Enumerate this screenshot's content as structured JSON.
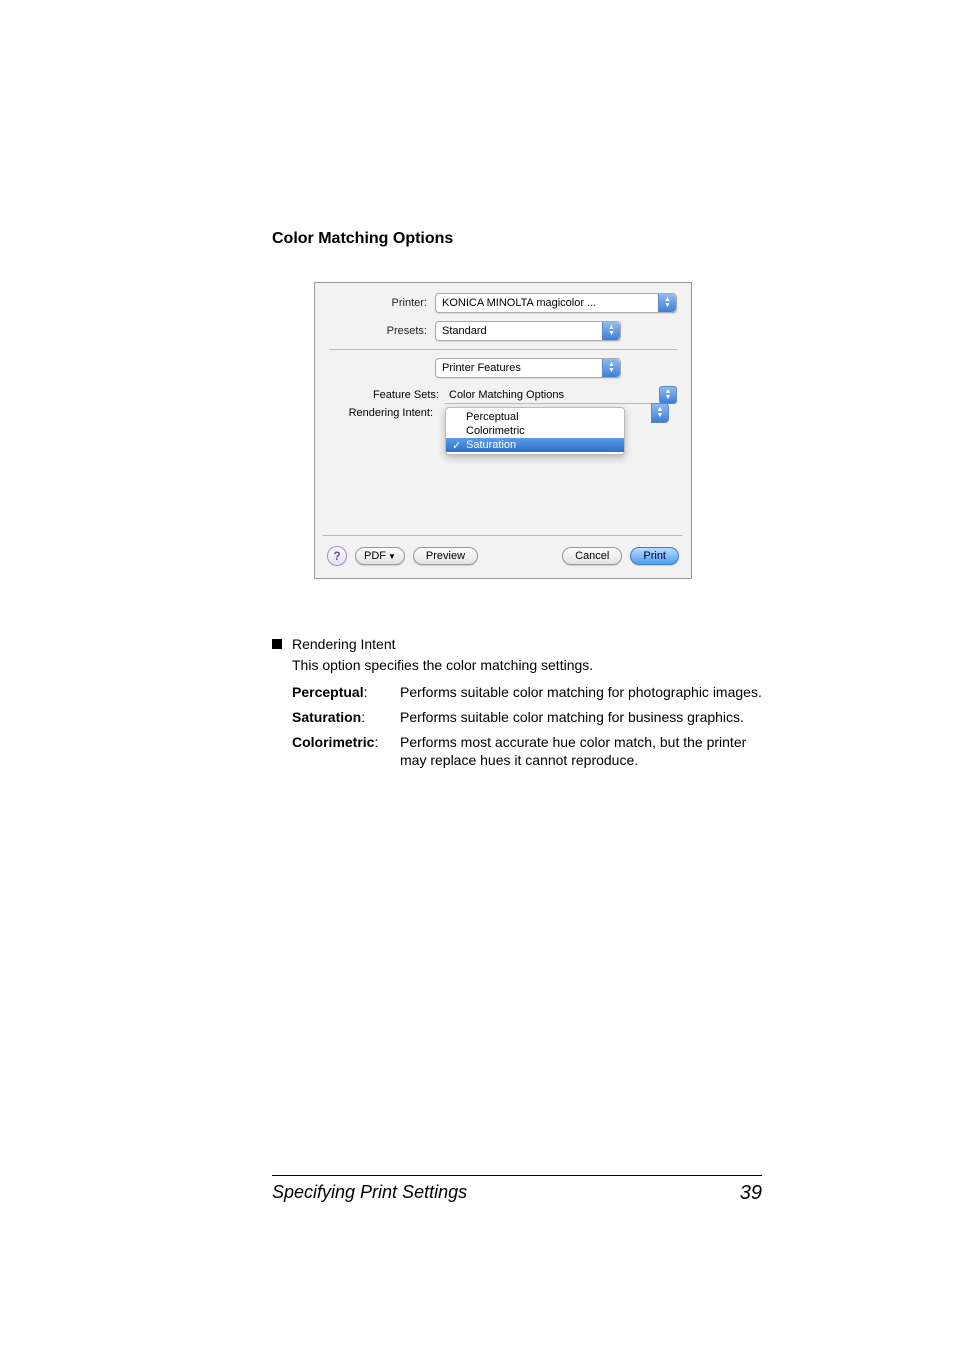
{
  "heading": "Color Matching Options",
  "dialog": {
    "printer_label": "Printer:",
    "printer_value": "KONICA MINOLTA magicolor ...",
    "presets_label": "Presets:",
    "presets_value": "Standard",
    "section_value": "Printer Features",
    "feature_sets_label": "Feature Sets:",
    "feature_sets_value": "Color Matching Options",
    "rendering_label": "Rendering Intent:",
    "menu": {
      "perceptual": "Perceptual",
      "colorimetric": "Colorimetric",
      "saturation": "Saturation"
    },
    "buttons": {
      "help": "?",
      "pdf": "PDF",
      "preview": "Preview",
      "cancel": "Cancel",
      "print": "Print"
    }
  },
  "bullet": {
    "title": "Rendering Intent",
    "desc": "This option specifies the color matching settings."
  },
  "defs": {
    "perceptual_term": "Perceptual",
    "perceptual_text": "Performs suitable color matching for photographic images.",
    "saturation_term": "Saturation",
    "saturation_text": "Performs suitable color matching for business graphics.",
    "colorimetric_term": "Colorimetric",
    "colorimetric_text": "Performs most accurate hue color match, but the printer may replace hues it cannot reproduce."
  },
  "footer": {
    "left": "Specifying Print Settings",
    "right": "39"
  }
}
